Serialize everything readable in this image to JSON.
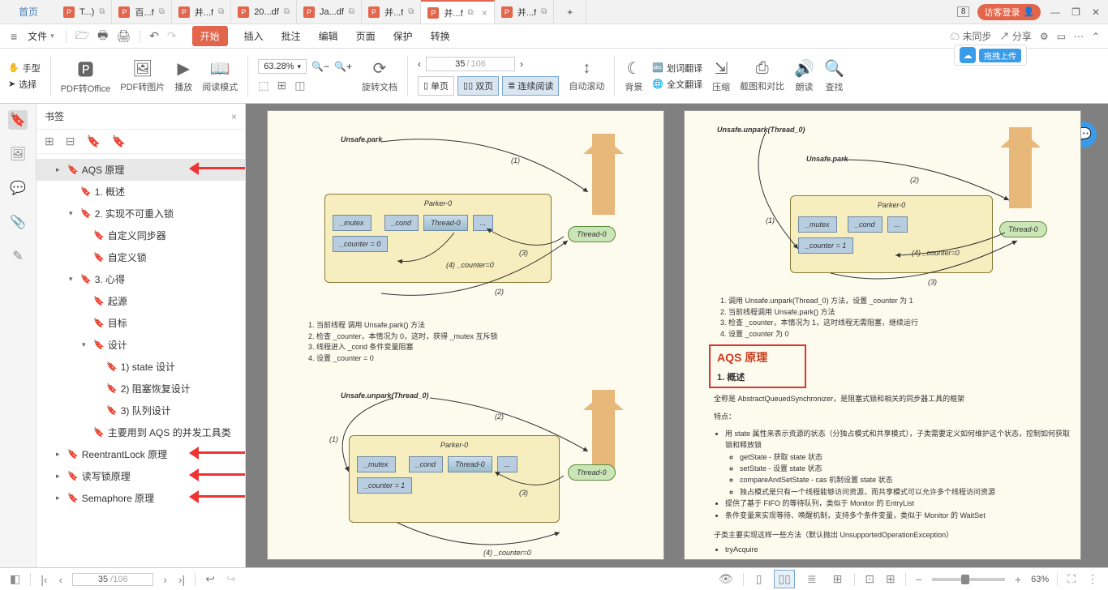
{
  "titlebar": {
    "home": "首页",
    "tabs": [
      {
        "label": "T...)"
      },
      {
        "label": "百...f"
      },
      {
        "label": "并...f"
      },
      {
        "label": "20...df"
      },
      {
        "label": "Ja...df"
      },
      {
        "label": "并...f"
      },
      {
        "label": "并...f",
        "active": true
      },
      {
        "label": "并...f"
      }
    ],
    "newtab": "+",
    "notif_count": "8",
    "login": "访客登录"
  },
  "menubar": {
    "file": "文件",
    "tabs": [
      "开始",
      "插入",
      "批注",
      "编辑",
      "页面",
      "保护",
      "转换"
    ],
    "active_tab": "开始",
    "sync": "未同步",
    "share": "分享"
  },
  "drag_upload": "拖拽上传",
  "ribbon": {
    "hand": "手型",
    "select": "选择",
    "pdf2office": "PDF转Office",
    "pdf2img": "PDF转图片",
    "play": "播放",
    "read_mode": "阅读模式",
    "zoom": "63.28%",
    "rotate": "旋转文档",
    "page_cur": "35",
    "page_total": "106",
    "single": "单页",
    "double": "双页",
    "continuous": "连续阅读",
    "autoscroll": "自动滚动",
    "bg": "背景",
    "word_trans": "划词翻译",
    "full_trans": "全文翻译",
    "compress": "压缩",
    "compare": "截图和对比",
    "read_aloud": "朗读",
    "find": "查找"
  },
  "bookmarks": {
    "title": "书签",
    "items": [
      {
        "indent": 1,
        "tw": "▸",
        "label": "AQS 原理",
        "sel": true,
        "arrow": true
      },
      {
        "indent": 2,
        "tw": "",
        "label": "1. 概述"
      },
      {
        "indent": 2,
        "tw": "▾",
        "label": "2. 实现不可重入锁"
      },
      {
        "indent": 3,
        "tw": "",
        "label": "自定义同步器"
      },
      {
        "indent": 3,
        "tw": "",
        "label": "自定义锁"
      },
      {
        "indent": 2,
        "tw": "▾",
        "label": "3. 心得"
      },
      {
        "indent": 3,
        "tw": "",
        "label": "起源"
      },
      {
        "indent": 3,
        "tw": "",
        "label": "目标"
      },
      {
        "indent": 3,
        "tw": "▾",
        "label": "设计"
      },
      {
        "indent": 4,
        "tw": "",
        "label": "1) state 设计"
      },
      {
        "indent": 4,
        "tw": "",
        "label": "2) 阻塞恢复设计"
      },
      {
        "indent": 4,
        "tw": "",
        "label": "3) 队列设计"
      },
      {
        "indent": 3,
        "tw": "",
        "label": "主要用到 AQS 的并发工具类"
      },
      {
        "indent": 1,
        "tw": "▸",
        "label": "ReentrantLock 原理",
        "arrow": true
      },
      {
        "indent": 1,
        "tw": "▸",
        "label": "读写锁原理",
        "arrow": true
      },
      {
        "indent": 1,
        "tw": "▸",
        "label": "Semaphore 原理",
        "arrow": true
      }
    ]
  },
  "doc": {
    "parker_title": "Parker-0",
    "mutex": "_mutex",
    "cond": "_cond",
    "thread0": "Thread-0",
    "dots": "...",
    "counter0": "_counter = 0",
    "counter1": "_counter = 1",
    "thread_pill": "Thread-0",
    "unsafe_park": "Unsafe.park",
    "unsafe_unpark": "Unsafe.unpark(Thread_0)",
    "left_notes1": [
      "1. 当前线程 调用 Unsafe.park() 方法",
      "2. 检查 _counter，本情况为 0，这时，获得 _mutex 互斥锁",
      "3. 线程进入 _cond 条件变量阻塞",
      "4. 设置 _counter = 0"
    ],
    "right_notes": [
      "1. 调用 Unsafe.unpark(Thread_0) 方法，设置 _counter 为 1",
      "2. 当前线程调用 Unsafe.park() 方法",
      "3. 检查 _counter，本情况为 1，这时线程无需阻塞，继续运行",
      "4. 设置 _counter 为 0"
    ],
    "aqs_title": "AQS 原理",
    "aqs_sub": "1. 概述",
    "aqs_intro": "全称是 AbstractQueuedSynchronizer，是阻塞式锁和相关的同步器工具的框架",
    "features_label": "特点：",
    "feat_state": "用 state 属性来表示资源的状态（分独占模式和共享模式），子类需要定义如何维护这个状态，控制如何获取锁和释放锁",
    "feat_sub": [
      "getState - 获取 state 状态",
      "setState - 设置 state 状态",
      "compareAndSetState - cas 机制设置 state 状态",
      "独占模式是只有一个线程能够访问资源，而共享模式可以允许多个线程访问资源"
    ],
    "feat_fifo": "提供了基于 FIFO 的等待队列，类似于 Monitor 的 EntryList",
    "feat_cond": "条件变量来实现等待、唤醒机制，支持多个条件变量，类似于 Monitor 的 WaitSet",
    "sub_methods": "子类主要实现这样一些方法（默认抛出 UnsupportedOperationException）",
    "try_acquire": "tryAcquire",
    "edge_labels": {
      "e1": "(1)",
      "e2": "(2)",
      "e3": "(3)",
      "e4": "(4) _counter=0"
    }
  },
  "status": {
    "page_cur": "35",
    "page_total": "106",
    "zoom": "63%"
  }
}
